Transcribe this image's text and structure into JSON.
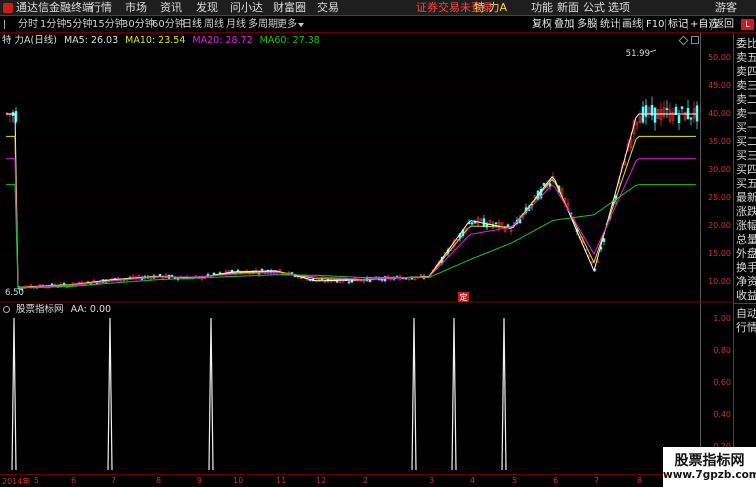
{
  "menubar": {
    "app_title": "通达信金融终端",
    "menus": [
      "行情",
      "市场",
      "资讯",
      "发现",
      "问小达",
      "财富圈",
      "交易"
    ],
    "login_status": "证券交易未登录",
    "stock_name": "特 力A",
    "right_items": [
      "功能",
      "新面",
      "公式",
      "选项"
    ],
    "guest": "游客"
  },
  "toolbar": {
    "periods": [
      "分时",
      "1分钟",
      "5分钟",
      "15分钟",
      "30分钟",
      "60分钟",
      "日线",
      "周线",
      "月线",
      "多周期",
      "更多"
    ],
    "active_period": "日线",
    "buttons": [
      "复权",
      "叠加",
      "多股",
      "统计",
      "画线",
      "F10",
      "标记",
      "+自选",
      "返回"
    ]
  },
  "legend": {
    "stock": "特 力A(日线)",
    "ma5": "MA5: 26.03",
    "ma10": "MA10: 23.54",
    "ma20": "MA20: 28.72",
    "ma60": "MA60: 27.38"
  },
  "annotations": {
    "high": "51.99",
    "low": "6.50",
    "marker": "定"
  },
  "y_axis": [
    "50.00",
    "45.00",
    "40.00",
    "35.00",
    "30.00",
    "25.00",
    "20.00",
    "15.00",
    "10.00"
  ],
  "indicator": {
    "name": "股票指标网",
    "value": "AA: 0.00",
    "y_axis": [
      "1.00",
      "0.80",
      "0.60",
      "0.40",
      "0.20"
    ]
  },
  "right_panel": {
    "top": [
      "委比",
      "卖五",
      "卖四",
      "卖三",
      "卖二",
      "卖一",
      "买一",
      "买二",
      "买三",
      "买四",
      "买五",
      "最新",
      "涨跌",
      "涨幅",
      "总量",
      "外盘",
      "换手",
      "净资",
      "收益"
    ],
    "bottom": [
      "自动",
      "行情"
    ]
  },
  "x_axis": [
    "2014年",
    "5",
    "6",
    "7",
    "8",
    "9",
    "10",
    "11",
    "12",
    "2",
    "3",
    "4",
    "5",
    "6",
    "7",
    "8"
  ],
  "watermark": {
    "title": "股票指标网",
    "url": "www.7gpzb.com"
  },
  "colors": {
    "ma5": "#ffffff",
    "ma10": "#e0e020",
    "ma20": "#e020e0",
    "ma60": "#20c020",
    "up": "#ff3232",
    "down": "#54ffff",
    "axis": "#cc3333"
  },
  "chart_data": [
    {
      "type": "line",
      "title": "特 力A(日线)",
      "y_range": [
        6.5,
        51.99
      ],
      "x": [
        "2014年",
        "5",
        "6",
        "7",
        "8",
        "9",
        "10",
        "11",
        "12",
        "2",
        "3",
        "4",
        "5",
        "6",
        "7",
        "8"
      ],
      "series": [
        {
          "name": "MA5",
          "values": [
            9.0,
            9.2,
            9.5,
            10.4,
            11.0,
            10.7,
            11.8,
            12.0,
            10.2,
            10.4,
            11.0,
            21.0,
            19.5,
            29.0,
            12.0,
            40.0
          ]
        },
        {
          "name": "MA10",
          "values": [
            9.0,
            9.2,
            9.5,
            10.3,
            11.0,
            10.8,
            11.6,
            11.9,
            10.6,
            10.4,
            11.0,
            20.0,
            19.8,
            28.5,
            13.5,
            36.0
          ]
        },
        {
          "name": "MA20",
          "values": [
            9.0,
            9.1,
            9.4,
            10.2,
            10.9,
            10.9,
            11.4,
            11.7,
            10.9,
            10.5,
            10.9,
            18.5,
            19.8,
            27.5,
            15.0,
            32.0
          ]
        },
        {
          "name": "MA60",
          "values": [
            9.0,
            9.0,
            9.2,
            9.8,
            10.4,
            10.7,
            11.0,
            11.3,
            11.2,
            10.8,
            10.8,
            14.0,
            17.0,
            21.0,
            22.0,
            27.4
          ]
        }
      ]
    },
    {
      "type": "bar",
      "title": "股票指标网",
      "y_range": [
        0,
        1
      ],
      "x": [
        "2014年",
        "5",
        "6",
        "7",
        "8",
        "9",
        "10",
        "11",
        "12",
        "2",
        "3",
        "4",
        "5",
        "6",
        "7",
        "8"
      ],
      "series": [
        {
          "name": "AA",
          "values": [
            1,
            0,
            1,
            0,
            1,
            0,
            0,
            0,
            0,
            1,
            1,
            1,
            0,
            0,
            0,
            0
          ]
        }
      ]
    }
  ]
}
